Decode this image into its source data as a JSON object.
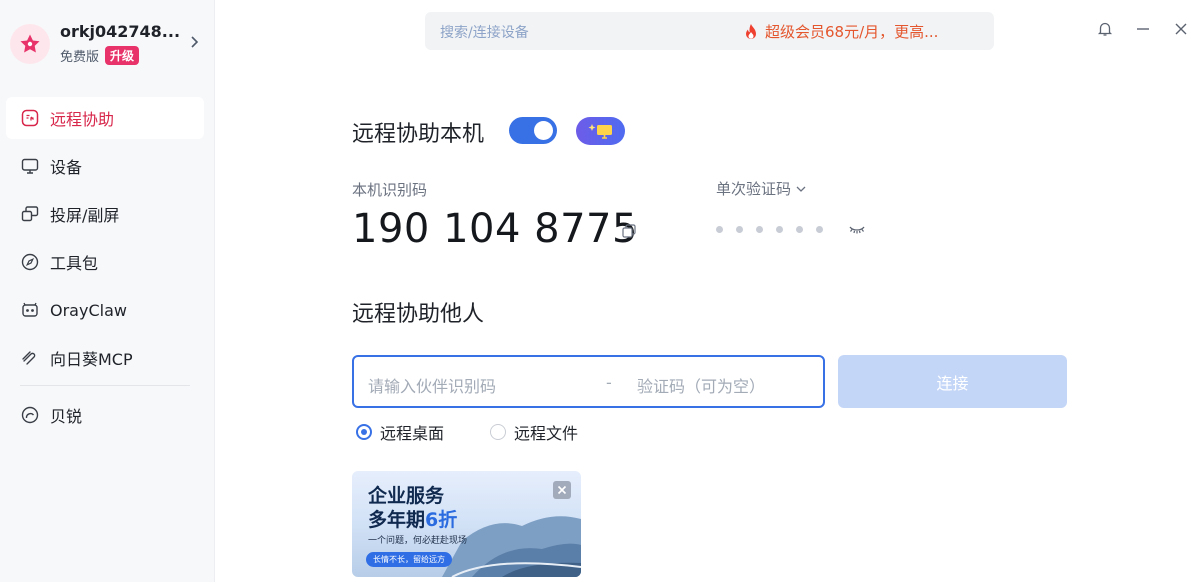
{
  "profile": {
    "username": "orkj042748...",
    "plan": "免费版",
    "upgrade": "升级"
  },
  "nav": {
    "items": [
      {
        "label": "远程协助",
        "icon": "remote-assist-icon",
        "active": true
      },
      {
        "label": "设备",
        "icon": "monitor-icon"
      },
      {
        "label": "投屏/副屏",
        "icon": "screen-cast-icon"
      },
      {
        "label": "工具包",
        "icon": "compass-icon"
      },
      {
        "label": "OrayClaw",
        "icon": "claw-icon"
      },
      {
        "label": "向日葵MCP",
        "icon": "mcp-icon"
      },
      {
        "label": "贝锐",
        "icon": "oray-icon"
      }
    ]
  },
  "topbar": {
    "search_placeholder": "搜索/连接设备",
    "promo_text": "超级会员68元/月，更高..."
  },
  "assist_self": {
    "title": "远程协助本机",
    "toggle_on": true,
    "device_id_label": "本机识别码",
    "device_id": "190 104 8775",
    "code_type_label": "单次验证码"
  },
  "assist_other": {
    "title": "远程协助他人",
    "partner_id_placeholder": "请输入伙伴识别码",
    "separator": "-",
    "code_placeholder": "验证码（可为空）",
    "connect_label": "连接",
    "modes": [
      {
        "label": "远程桌面",
        "checked": true
      },
      {
        "label": "远程文件",
        "checked": false
      }
    ]
  },
  "ad": {
    "line1": "企业服务",
    "line2_prefix": "多年期",
    "line2_highlight": "6折",
    "subline": "一个问题，何必赶赴现场",
    "pill": "长情不长，留给远方"
  },
  "colors": {
    "accent": "#3871e6",
    "active_nav": "#d7264a",
    "promo": "#e4572e",
    "upgrade_badge": "#e8336a"
  }
}
